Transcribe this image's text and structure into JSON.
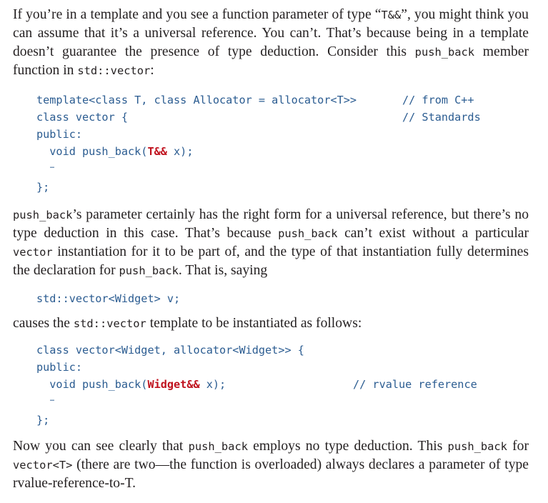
{
  "p1": {
    "t1": "If you’re in a template and you see a function parameter of type “",
    "t2": "T&&",
    "t3": "”, you might think you can assume that it’s a universal reference. You can’t. That’s because being in a template doesn’t guarantee the presence of type deduction. Consider this ",
    "t4": "push_back",
    "t5": " member function in ",
    "t6": "std::vector",
    "t7": ":"
  },
  "code1": {
    "line1": "template<class T, class Allocator = allocator<T>>",
    "line2": "class vector {",
    "line3": "public:",
    "line4a": "  void push_back(",
    "line4b": "T&&",
    "line4c": " x);",
    "dots": "…",
    "line6": "};",
    "comment1": "// from C++",
    "comment2": "// Standards"
  },
  "p2": {
    "t1": "push_back",
    "t2": "’s parameter certainly has the right form for a universal reference, but there’s no type deduction in this case. That’s because ",
    "t3": "push_back",
    "t4": " can’t exist without a particular ",
    "t5": "vector",
    "t6": " instantiation for it to be part of, and the type of that instantiation fully determines the declaration for ",
    "t7": "push_back",
    "t8": ". That is, saying"
  },
  "code2": {
    "line1": "std::vector<Widget> v;"
  },
  "p3": {
    "t1": "causes the ",
    "t2": "std::vector",
    "t3": " template to be instantiated as follows:"
  },
  "code3": {
    "line1": "class vector<Widget, allocator<Widget>> {",
    "line2": "public:",
    "line3a": "  void push_back(",
    "line3b": "Widget&&",
    "line3c": " x);",
    "dots": "…",
    "line5": "};",
    "comment": "// rvalue reference"
  },
  "p4": {
    "t1": "Now you can see clearly that ",
    "t2": "push_back",
    "t3": " employs no type deduction. This ",
    "t4": "push_back",
    "t5": " for ",
    "t6": "vector<T>",
    "t7": " (there are two—the function is overloaded) always declares a parameter of type rvalue-reference-to-T."
  }
}
